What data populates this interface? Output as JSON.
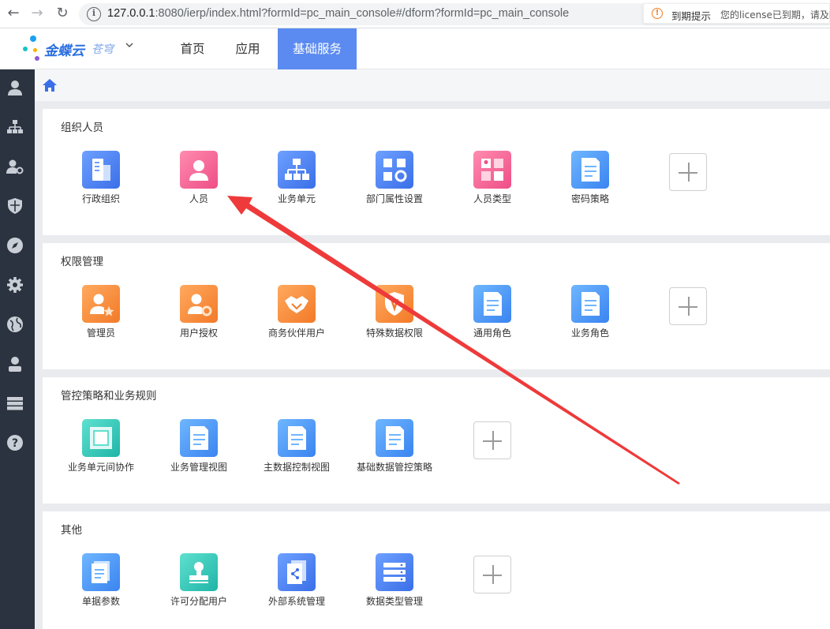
{
  "browser": {
    "url_host": "127.0.0.1",
    "url_rest": ":8080/ierp/index.html?formId=pc_main_console#/dform?formId=pc_main_console"
  },
  "header": {
    "brand": "金蝶云",
    "brand_sub": "苍穹",
    "tabs": [
      {
        "label": "首页"
      },
      {
        "label": "应用"
      },
      {
        "label": "基础服务"
      }
    ],
    "active_tab": "基础服务",
    "notice_title": "到期提示",
    "notice_message": "您的license已到期，请及时"
  },
  "sidebar": {
    "items": [
      "user-icon",
      "org-chart-icon",
      "user-settings-icon",
      "shield-icon",
      "compass-icon",
      "gear-icon",
      "globe-icon",
      "person-icon",
      "server-icon",
      "help-icon"
    ]
  },
  "sections": [
    {
      "title": "组织人员",
      "tiles": [
        {
          "label": "行政组织",
          "icon": "building-icon",
          "color": "blue"
        },
        {
          "label": "人员",
          "icon": "person-icon",
          "color": "pink"
        },
        {
          "label": "业务单元",
          "icon": "org-chart-icon",
          "color": "blue"
        },
        {
          "label": "部门属性设置",
          "icon": "grid-gear-icon",
          "color": "blue"
        },
        {
          "label": "人员类型",
          "icon": "person-grid-icon",
          "color": "pink"
        },
        {
          "label": "密码策略",
          "icon": "document-icon",
          "color": "sky"
        }
      ]
    },
    {
      "title": "权限管理",
      "tiles": [
        {
          "label": "管理员",
          "icon": "admin-star-icon",
          "color": "orange"
        },
        {
          "label": "用户授权",
          "icon": "user-gear-icon",
          "color": "orange"
        },
        {
          "label": "商务伙伴用户",
          "icon": "handshake-icon",
          "color": "orange"
        },
        {
          "label": "特殊数据权限",
          "icon": "shield-icon",
          "color": "orange"
        },
        {
          "label": "通用角色",
          "icon": "document-icon",
          "color": "sky"
        },
        {
          "label": "业务角色",
          "icon": "document-icon",
          "color": "sky"
        }
      ]
    },
    {
      "title": "管控策略和业务规则",
      "tiles": [
        {
          "label": "业务单元间协作",
          "icon": "layers-icon",
          "color": "teal"
        },
        {
          "label": "业务管理视图",
          "icon": "document-icon",
          "color": "sky"
        },
        {
          "label": "主数据控制视图",
          "icon": "document-icon",
          "color": "sky"
        },
        {
          "label": "基础数据管控策略",
          "icon": "document-icon",
          "color": "sky"
        }
      ]
    },
    {
      "title": "其他",
      "tiles": [
        {
          "label": "单据参数",
          "icon": "stacked-docs-icon",
          "color": "sky"
        },
        {
          "label": "许可分配用户",
          "icon": "stamp-icon",
          "color": "teal"
        },
        {
          "label": "外部系统管理",
          "icon": "share-docs-icon",
          "color": "blue"
        },
        {
          "label": "数据类型管理",
          "icon": "list-icon",
          "color": "blue"
        }
      ]
    }
  ],
  "annotation": {
    "color": "#ee3a3a"
  }
}
